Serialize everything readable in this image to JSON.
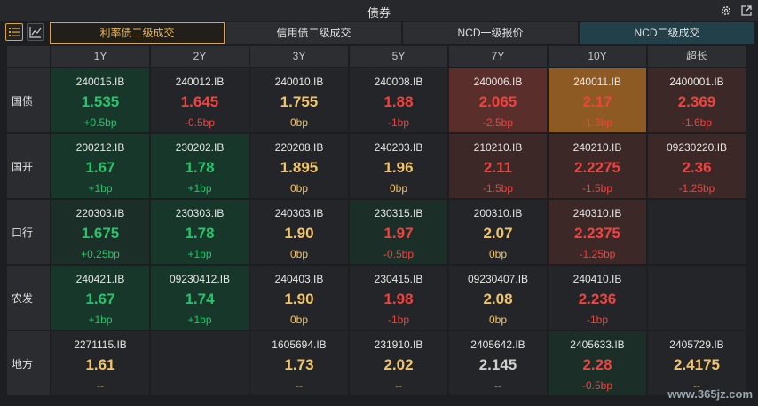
{
  "window": {
    "title": "债券"
  },
  "tabs": [
    {
      "label": "利率债二级成交",
      "active": true
    },
    {
      "label": "信用债二级成交",
      "active": false
    },
    {
      "label": "NCD一级报价",
      "active": false
    },
    {
      "label": "NCD二级成交",
      "active": false
    }
  ],
  "columns": [
    "1Y",
    "2Y",
    "3Y",
    "5Y",
    "7Y",
    "10Y",
    "超长"
  ],
  "colors": {
    "green": "#27c46b",
    "red": "#f0433f",
    "yellow": "#f2c46a",
    "accent": "#d9a74a"
  },
  "rows": [
    {
      "label": "国债",
      "cells": [
        {
          "code": "240015.IB",
          "yield": "1.535",
          "change": "+0.5bp",
          "tone": "g",
          "bg": "#17372a"
        },
        {
          "code": "240012.IB",
          "yield": "1.645",
          "change": "-0.5bp",
          "tone": "r",
          "bg": "#232528"
        },
        {
          "code": "240010.IB",
          "yield": "1.755",
          "change": "0bp",
          "tone": "y",
          "bg": "#232528"
        },
        {
          "code": "240008.IB",
          "yield": "1.88",
          "change": "-1bp",
          "tone": "r",
          "bg": "#232528"
        },
        {
          "code": "240006.IB",
          "yield": "2.065",
          "change": "-2.5bp",
          "tone": "r",
          "bg": "#5a2e2a"
        },
        {
          "code": "240011.IB",
          "yield": "2.17",
          "change": "-1.3bp",
          "tone": "r",
          "bg": "#8c5a22"
        },
        {
          "code": "2400001.IB",
          "yield": "2.369",
          "change": "-1.6bp",
          "tone": "r",
          "bg": "#3c2826"
        }
      ]
    },
    {
      "label": "国开",
      "cells": [
        {
          "code": "200212.IB",
          "yield": "1.67",
          "change": "+1bp",
          "tone": "g",
          "bg": "#17372a"
        },
        {
          "code": "230202.IB",
          "yield": "1.78",
          "change": "+1bp",
          "tone": "g",
          "bg": "#17372a"
        },
        {
          "code": "220208.IB",
          "yield": "1.895",
          "change": "0bp",
          "tone": "y",
          "bg": "#232528"
        },
        {
          "code": "240203.IB",
          "yield": "1.96",
          "change": "0bp",
          "tone": "y",
          "bg": "#232528"
        },
        {
          "code": "210210.IB",
          "yield": "2.11",
          "change": "-1.5bp",
          "tone": "r",
          "bg": "#3c2826"
        },
        {
          "code": "240210.IB",
          "yield": "2.2275",
          "change": "-1.5bp",
          "tone": "r",
          "bg": "#3c2826"
        },
        {
          "code": "09230220.IB",
          "yield": "2.36",
          "change": "-1.25bp",
          "tone": "r",
          "bg": "#3c2826"
        }
      ]
    },
    {
      "label": "口行",
      "cells": [
        {
          "code": "220303.IB",
          "yield": "1.675",
          "change": "+0.25bp",
          "tone": "g",
          "bg": "#1b2e27"
        },
        {
          "code": "230303.IB",
          "yield": "1.78",
          "change": "+1bp",
          "tone": "g",
          "bg": "#17372a"
        },
        {
          "code": "240303.IB",
          "yield": "1.90",
          "change": "0bp",
          "tone": "y",
          "bg": "#232528"
        },
        {
          "code": "230315.IB",
          "yield": "1.97",
          "change": "-0.5bp",
          "tone": "r",
          "bg": "#1b2e27"
        },
        {
          "code": "200310.IB",
          "yield": "2.07",
          "change": "0bp",
          "tone": "y",
          "bg": "#232528"
        },
        {
          "code": "240310.IB",
          "yield": "2.2375",
          "change": "-1.25bp",
          "tone": "r",
          "bg": "#3c2826"
        },
        {
          "code": "",
          "yield": "",
          "change": "",
          "tone": "w",
          "bg": "#232528"
        }
      ]
    },
    {
      "label": "农发",
      "cells": [
        {
          "code": "240421.IB",
          "yield": "1.67",
          "change": "+1bp",
          "tone": "g",
          "bg": "#17372a"
        },
        {
          "code": "09230412.IB",
          "yield": "1.74",
          "change": "+1bp",
          "tone": "g",
          "bg": "#17372a"
        },
        {
          "code": "240403.IB",
          "yield": "1.90",
          "change": "0bp",
          "tone": "y",
          "bg": "#232528"
        },
        {
          "code": "230415.IB",
          "yield": "1.98",
          "change": "-1bp",
          "tone": "r",
          "bg": "#232528"
        },
        {
          "code": "09230407.IB",
          "yield": "2.08",
          "change": "0bp",
          "tone": "y",
          "bg": "#232528"
        },
        {
          "code": "240410.IB",
          "yield": "2.236",
          "change": "-1bp",
          "tone": "r",
          "bg": "#232528"
        },
        {
          "code": "",
          "yield": "",
          "change": "",
          "tone": "w",
          "bg": "#232528"
        }
      ]
    },
    {
      "label": "地方",
      "cells": [
        {
          "code": "2271115.IB",
          "yield": "1.61",
          "change": "--",
          "tone": "y",
          "bg": "#232528"
        },
        {
          "code": "",
          "yield": "",
          "change": "",
          "tone": "w",
          "bg": "#232528"
        },
        {
          "code": "1605694.IB",
          "yield": "1.73",
          "change": "--",
          "tone": "y",
          "bg": "#232528"
        },
        {
          "code": "231910.IB",
          "yield": "2.02",
          "change": "--",
          "tone": "y",
          "bg": "#232528"
        },
        {
          "code": "2405642.IB",
          "yield": "2.145",
          "change": "--",
          "tone": "w",
          "bg": "#232528"
        },
        {
          "code": "2405633.IB",
          "yield": "2.28",
          "change": "-0.5bp",
          "tone": "r",
          "bg": "#1b2e27"
        },
        {
          "code": "2405729.IB",
          "yield": "2.4175",
          "change": "--",
          "tone": "y",
          "bg": "#232528"
        }
      ]
    }
  ],
  "watermark": "www.365jz.com"
}
